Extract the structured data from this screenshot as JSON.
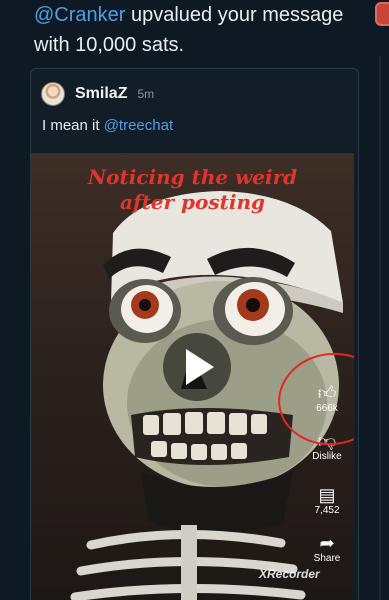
{
  "notification": {
    "mention": "@Cranker",
    "text": " upvalued your message with 10,000 sats."
  },
  "post": {
    "author": "SmilaZ",
    "time": "5m",
    "text": "I mean it ",
    "mention": "@treechat"
  },
  "video": {
    "caption_line1": "Noticing the weird",
    "caption_line2": "after posting",
    "like_count": "666k",
    "dislike_label": "Dislike",
    "comment_count": "7,452",
    "share_label": "Share",
    "watermark": "XRecorder"
  },
  "colors": {
    "background": "#0f1923",
    "mention": "#4ea0e6",
    "caption": "#e0342c",
    "annotation": "#e5251f"
  }
}
